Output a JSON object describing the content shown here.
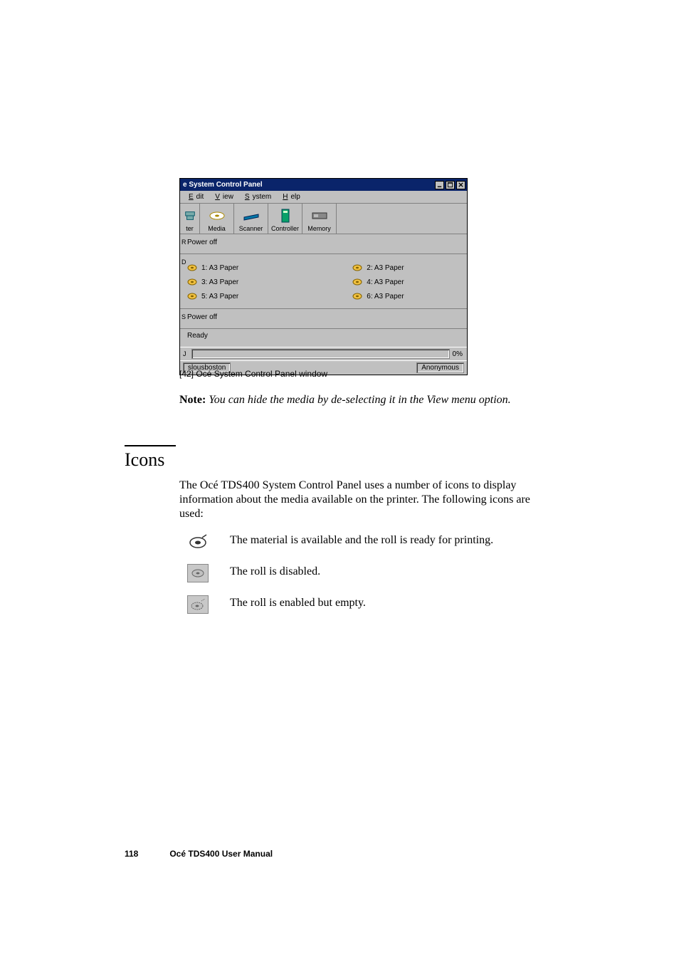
{
  "window": {
    "title": "e System Control Panel",
    "menus": {
      "edit": "Edit",
      "view": "View",
      "system": "System",
      "help": "Help"
    },
    "toolbar": {
      "t0": "ter",
      "t1": "Media",
      "t2": "Scanner",
      "t3": "Controller",
      "t4": "Memory"
    },
    "section_printer": {
      "marker": "R",
      "header": "Power off"
    },
    "section_media": {
      "marker": "D",
      "left": [
        {
          "label": "1: A3 Paper"
        },
        {
          "label": "3: A3 Paper"
        },
        {
          "label": "5: A3 Paper"
        }
      ],
      "right": [
        {
          "label": "2: A3 Paper"
        },
        {
          "label": "4: A3 Paper"
        },
        {
          "label": "6: A3 Paper"
        }
      ]
    },
    "section_scanner": {
      "marker": "S",
      "header": "Power off"
    },
    "section_ctrl": {
      "header": "Ready"
    },
    "progress": {
      "marker": "J",
      "pct": "0%"
    },
    "status_left": "slousboston",
    "status_right": "Anonymous"
  },
  "fig_caption": "[42] Océ System Control Panel window",
  "note_label": "Note:",
  "note_text": " You can hide the media by de-selecting it in the View menu option.",
  "heading_icons": "Icons",
  "paragraph": "The Océ TDS400 System Control Panel uses a number of icons to display information about the media available on the printer. The following icons are used:",
  "icon_rows": {
    "r0": "The material is available and the roll is ready for printing.",
    "r1": "The roll is disabled.",
    "r2": " The roll is enabled but empty."
  },
  "footer": {
    "page_no": "118",
    "manual": "Océ TDS400 User Manual"
  }
}
